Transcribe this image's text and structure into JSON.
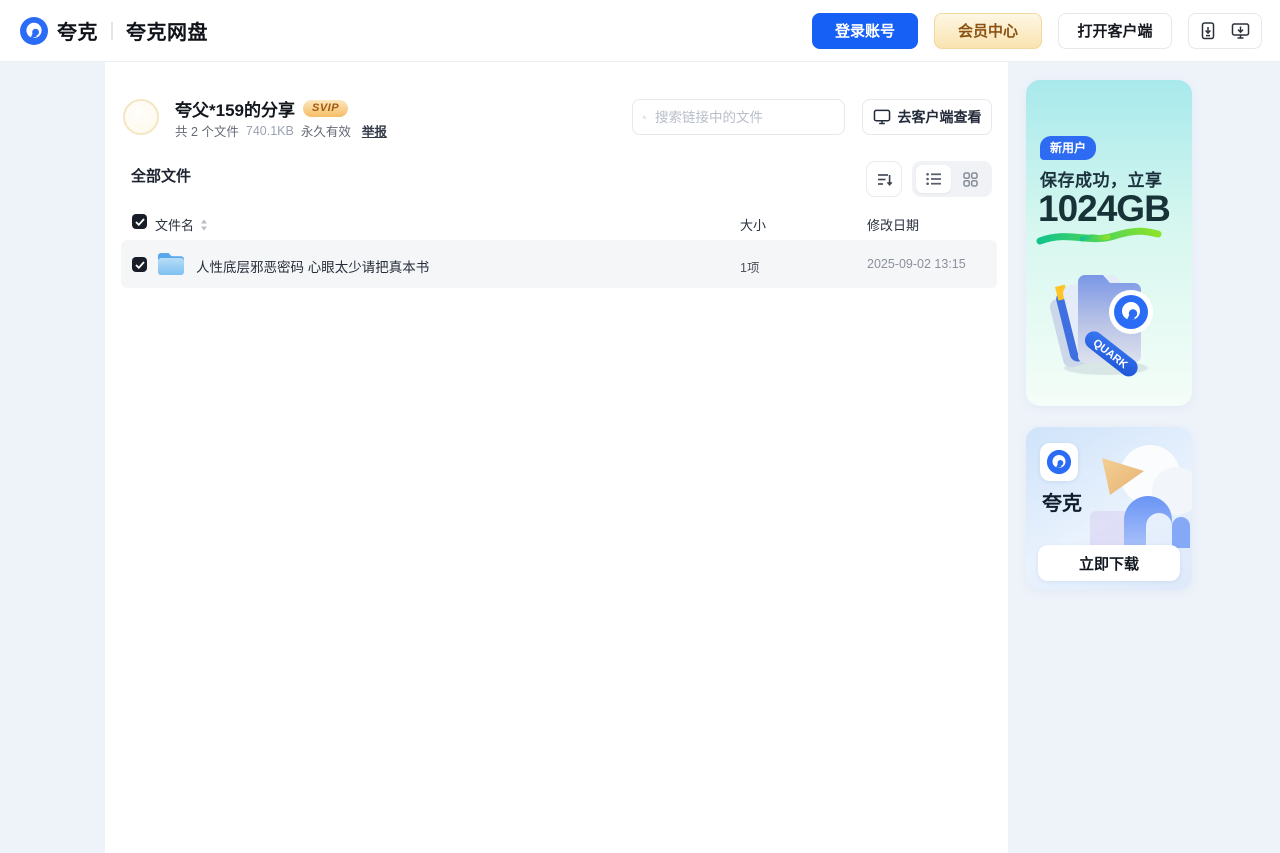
{
  "header": {
    "brand": "夸克",
    "brand_product": "夸克网盘",
    "login_button": "登录账号",
    "vip_button": "会员中心",
    "open_client_button": "打开客户端"
  },
  "share": {
    "title": "夸父*159的分享",
    "svip_badge": "SVIP",
    "meta_count": "共 2 个文件",
    "meta_size": "740.1KB",
    "meta_validity": "永久有效",
    "report_link": "举报",
    "search_placeholder": "搜索链接中的文件",
    "client_button": "去客户端查看"
  },
  "files": {
    "section_title": "全部文件",
    "columns": {
      "name": "文件名",
      "size": "大小",
      "date": "修改日期"
    },
    "rows": [
      {
        "type": "folder",
        "name": "人性底层邪恶密码 心眼太少请把真本书",
        "size": "1项",
        "date": "2025-09-02 13:15"
      }
    ]
  },
  "promo_top": {
    "badge": "新用户",
    "line1": "保存成功，立享",
    "line2": "1024GB",
    "ribbon": "QUARK"
  },
  "promo_bottom": {
    "app_name": "夸克",
    "download_button": "立即下载"
  },
  "colors": {
    "accent_blue": "#1660f5",
    "vip_gold": "#f6bd66",
    "swoosh_green_start": "#12c48b",
    "swoosh_green_end": "#8ce32a",
    "page_bg": "#eef3fa"
  }
}
